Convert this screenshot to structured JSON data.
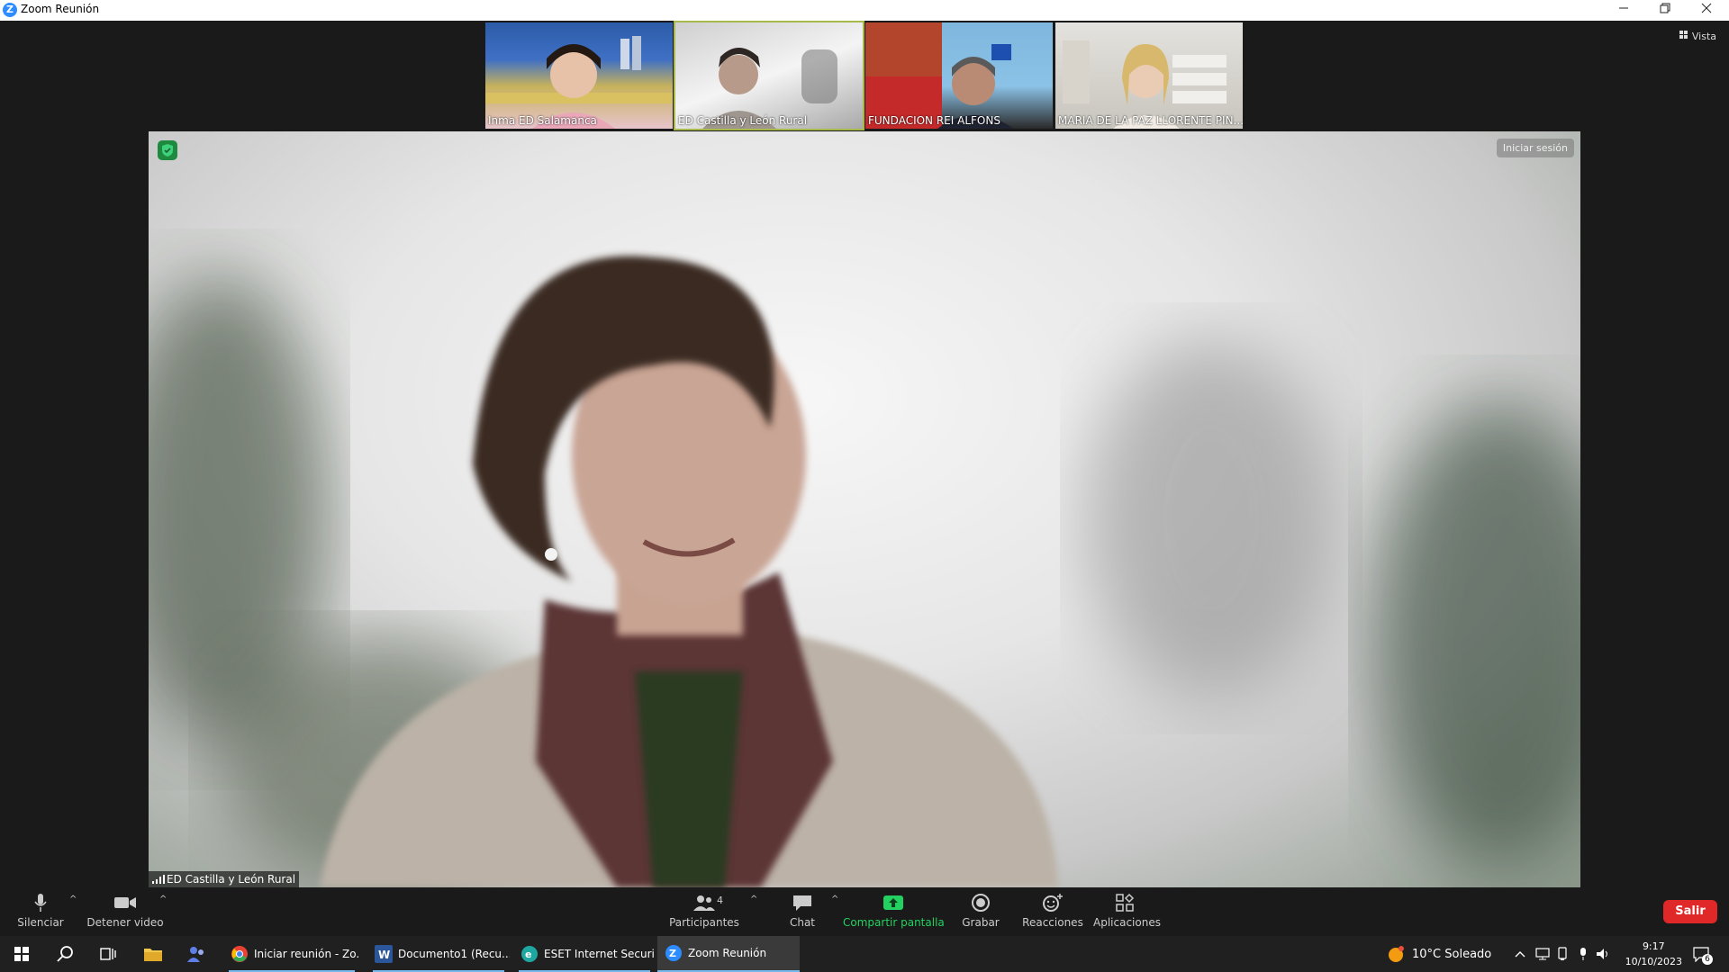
{
  "window": {
    "title": "Zoom Reunión",
    "controls": [
      "minimize-icon",
      "restore-icon",
      "close-icon"
    ]
  },
  "top_strip": {
    "view_label": "Vista",
    "participants": [
      {
        "name": "Inma ED Salamanca",
        "active": false
      },
      {
        "name": "ED Castilla y León Rural",
        "active": true
      },
      {
        "name": "FUNDACION REI ALFONS",
        "active": false
      },
      {
        "name": "MARIA DE LA PAZ LLORENTE PIN...",
        "active": false
      }
    ]
  },
  "main_video": {
    "speaker_name": "ED Castilla y León Rural",
    "login_label": "Iniciar sesión"
  },
  "toolbar": {
    "mute_label": "Silenciar",
    "video_label": "Detener video",
    "participants_label": "Participantes",
    "participants_count": "4",
    "chat_label": "Chat",
    "share_label": "Compartir pantalla",
    "record_label": "Grabar",
    "reactions_label": "Reacciones",
    "apps_label": "Aplicaciones",
    "leave_label": "Salir",
    "share_color": "#23d160",
    "leave_color": "#e02828"
  },
  "taskbar": {
    "apps": [
      {
        "label": "Iniciar reunión - Zo...",
        "icon": "chrome-icon"
      },
      {
        "label": "Documento1 (Recu...",
        "icon": "word-icon"
      },
      {
        "label": "ESET Internet Securi...",
        "icon": "eset-icon"
      },
      {
        "label": "Zoom Reunión",
        "icon": "zoom-icon"
      }
    ],
    "weather": "10°C  Soleado",
    "time": "9:17",
    "date": "10/10/2023",
    "notifications_count": "6"
  }
}
